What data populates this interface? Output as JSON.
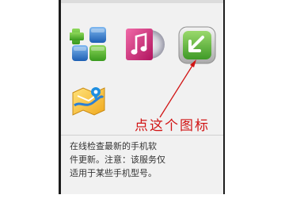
{
  "apps": [
    {
      "name": "app-store",
      "icon": "blocks-icon"
    },
    {
      "name": "music-player",
      "icon": "music-note-icon"
    },
    {
      "name": "software-update",
      "icon": "download-arrow-icon"
    },
    {
      "name": "maps",
      "icon": "map-icon"
    }
  ],
  "annotation": {
    "label": "点这个图标",
    "color": "#d11414"
  },
  "description": {
    "line1": "在线检查最新的手机软",
    "line2": "件更新。注意：该服务仅",
    "line3": "适用于某些手机型号。"
  },
  "colors": {
    "panel_bg": "#f1f1f1",
    "frame": "#1c1c1c",
    "accent_green": "#4cae2c",
    "accent_blue": "#2673c8",
    "accent_pink": "#d8267c"
  }
}
